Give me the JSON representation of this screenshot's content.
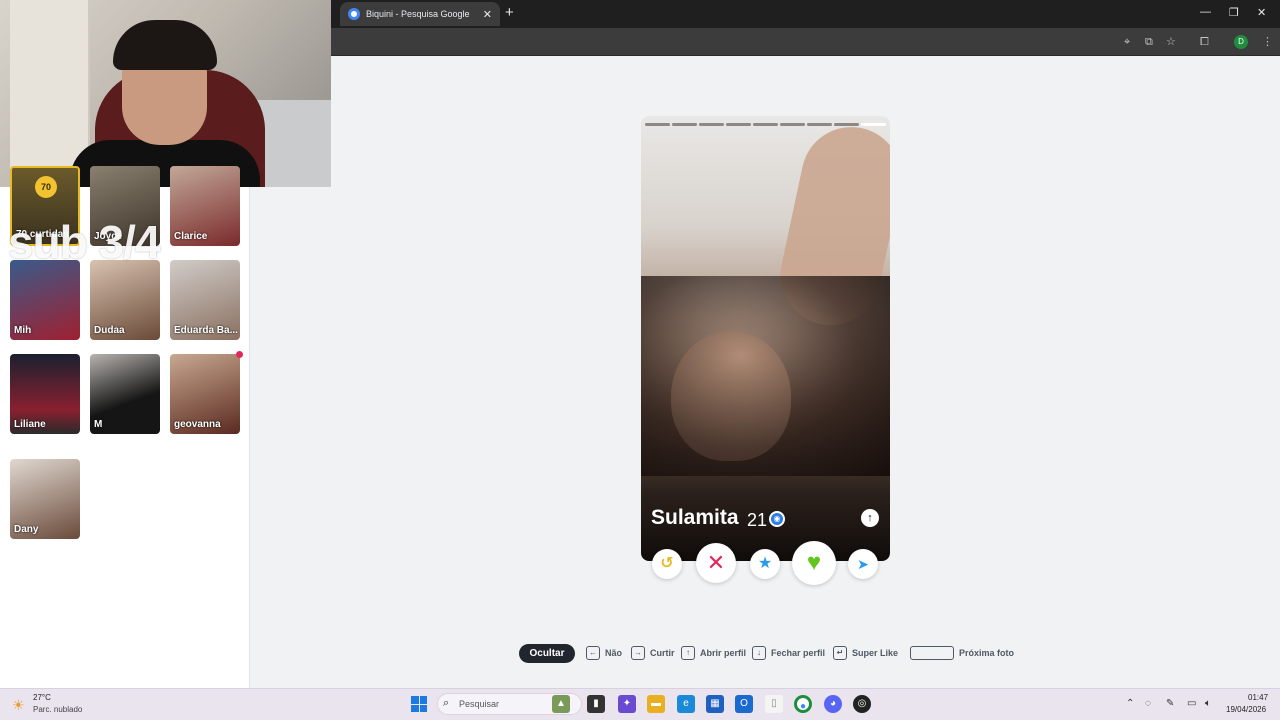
{
  "browser": {
    "tab_title": "Biquini - Pesquisa Google",
    "tab_close": "✕",
    "new_tab": "+",
    "profile_initial": "D",
    "window_controls": [
      "—",
      "❐",
      "✕"
    ]
  },
  "sidebar": {
    "likes_badge": "70",
    "likes_label": "70 curtidas",
    "overlay_text": "sub 3/4",
    "matches": [
      {
        "name": "Joyce"
      },
      {
        "name": "Clarice"
      },
      {
        "name": "Mih"
      },
      {
        "name": "Dudaa"
      },
      {
        "name": "Eduarda Ba..."
      },
      {
        "name": "Liliane"
      },
      {
        "name": "M"
      },
      {
        "name": "geovanna"
      },
      {
        "name": "Dany"
      }
    ]
  },
  "profile": {
    "name": "Sulamita",
    "age": "21",
    "photo_count": 9,
    "active_photo_index": 8
  },
  "actions": {
    "rewind_icon": "↺",
    "nope_icon": "✕",
    "super_icon": "★",
    "like_icon": "♥",
    "boost_icon": "➤"
  },
  "hints": {
    "hide": "Ocultar",
    "no": "Não",
    "like": "Curtir",
    "open_profile": "Abrir perfil",
    "close_profile": "Fechar perfil",
    "super_like": "Super Like",
    "next_photo": "Próxima foto"
  },
  "taskbar": {
    "temp": "27°C",
    "weather": "Parc. nublado",
    "search_placeholder": "Pesquisar",
    "time": "01:47",
    "date": "19/04/2026"
  },
  "colors": {
    "nope": "#e5265a",
    "like": "#65c51f",
    "super": "#2b9be9",
    "rewind": "#e8b923",
    "likes_gold": "#f2c230"
  }
}
